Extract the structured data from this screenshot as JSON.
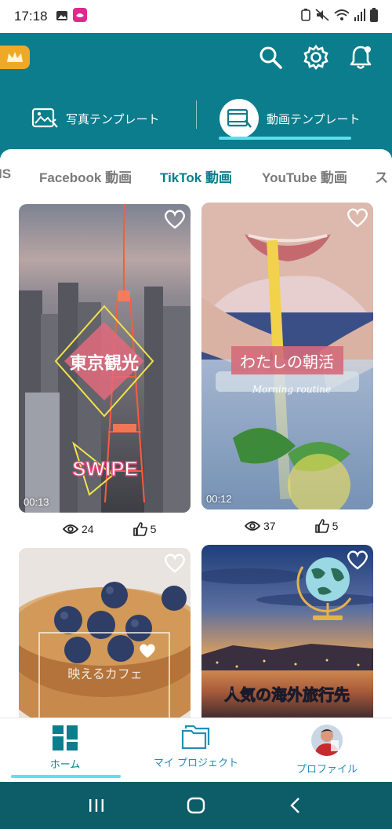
{
  "status_bar": {
    "time": "17:18",
    "icons": [
      "photo-icon",
      "app-notification-icon",
      "bluetooth-battery-icon",
      "mute-icon",
      "wifi-icon",
      "signal-icon",
      "battery-icon"
    ]
  },
  "header": {
    "premium_icon": "crown-icon",
    "actions": [
      "search-icon",
      "settings-icon",
      "notifications-icon"
    ],
    "modes": [
      {
        "label": "写真テンプレート",
        "icon": "photo-template-icon",
        "active": false
      },
      {
        "label": "動画テンプレート",
        "icon": "video-template-icon",
        "active": true
      }
    ],
    "colors": {
      "teal": "#0b7d8c",
      "accent": "#5de0ee",
      "premium": "#f0a927"
    }
  },
  "categories": [
    {
      "label": "IS",
      "active": false
    },
    {
      "label": "Facebook 動画",
      "active": false
    },
    {
      "label": "TikTok 動画",
      "active": true
    },
    {
      "label": "YouTube 動画",
      "active": false
    },
    {
      "label": "ス",
      "active": false
    }
  ],
  "templates": [
    {
      "title": "東京観光",
      "subtitle": "SWIPE",
      "duration": "00:13",
      "views": "24",
      "likes": "5"
    },
    {
      "title": "わたしの朝活",
      "subtitle": "Morning routine",
      "duration": "00:12",
      "views": "37",
      "likes": "5"
    },
    {
      "title": "映えるカフェ",
      "subtitle": "",
      "duration": "",
      "views": "",
      "likes": ""
    },
    {
      "title": "人気の海外旅行先",
      "subtitle": "",
      "duration": "",
      "views": "",
      "likes": ""
    }
  ],
  "bottom_nav": [
    {
      "label": "ホーム",
      "icon": "home-grid-icon",
      "active": true
    },
    {
      "label": "マイ プロジェクト",
      "icon": "folder-icon",
      "active": false
    },
    {
      "label": "プロファイル",
      "icon": "avatar",
      "active": false
    }
  ],
  "system_nav": [
    "recents-icon",
    "home-icon",
    "back-icon"
  ]
}
